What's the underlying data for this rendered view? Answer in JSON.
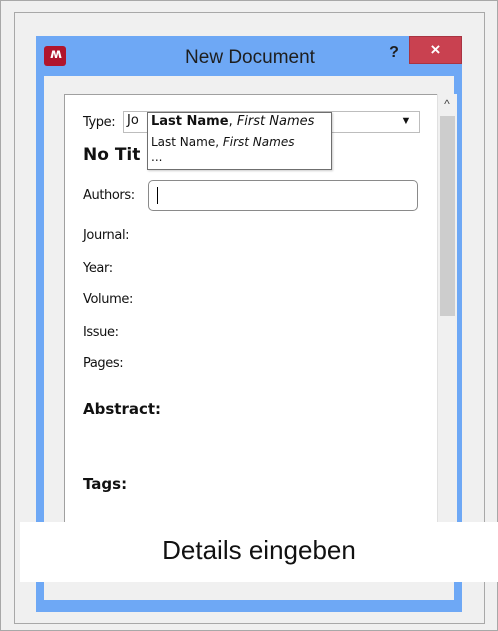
{
  "window": {
    "title": "New Document",
    "help_label": "?",
    "close_label": "×",
    "logo_text": "ʍ"
  },
  "details": {
    "type_label": "Type:",
    "type_value_visible": "Jo",
    "dropdown_icon": "▼",
    "title_placeholder": "No Tit",
    "fields": {
      "authors": "Authors:",
      "journal": "Journal:",
      "year": "Year:",
      "volume": "Volume:",
      "issue": "Issue:",
      "pages": "Pages:"
    },
    "authors_value": "",
    "sections": {
      "abstract": "Abstract:",
      "tags": "Tags:"
    }
  },
  "autocomplete": {
    "header_last": "Last Name",
    "header_sep": ", ",
    "header_first": "First Names",
    "item_last": "Last Name",
    "item_sep": ", ",
    "item_first": "First Names",
    "more": "..."
  },
  "scrollbar": {
    "up_icon": "^"
  },
  "caption": "Details eingeben",
  "colors": {
    "title_bar": "#6ea8f5",
    "close_button": "#c94150",
    "logo": "#b0152d"
  }
}
